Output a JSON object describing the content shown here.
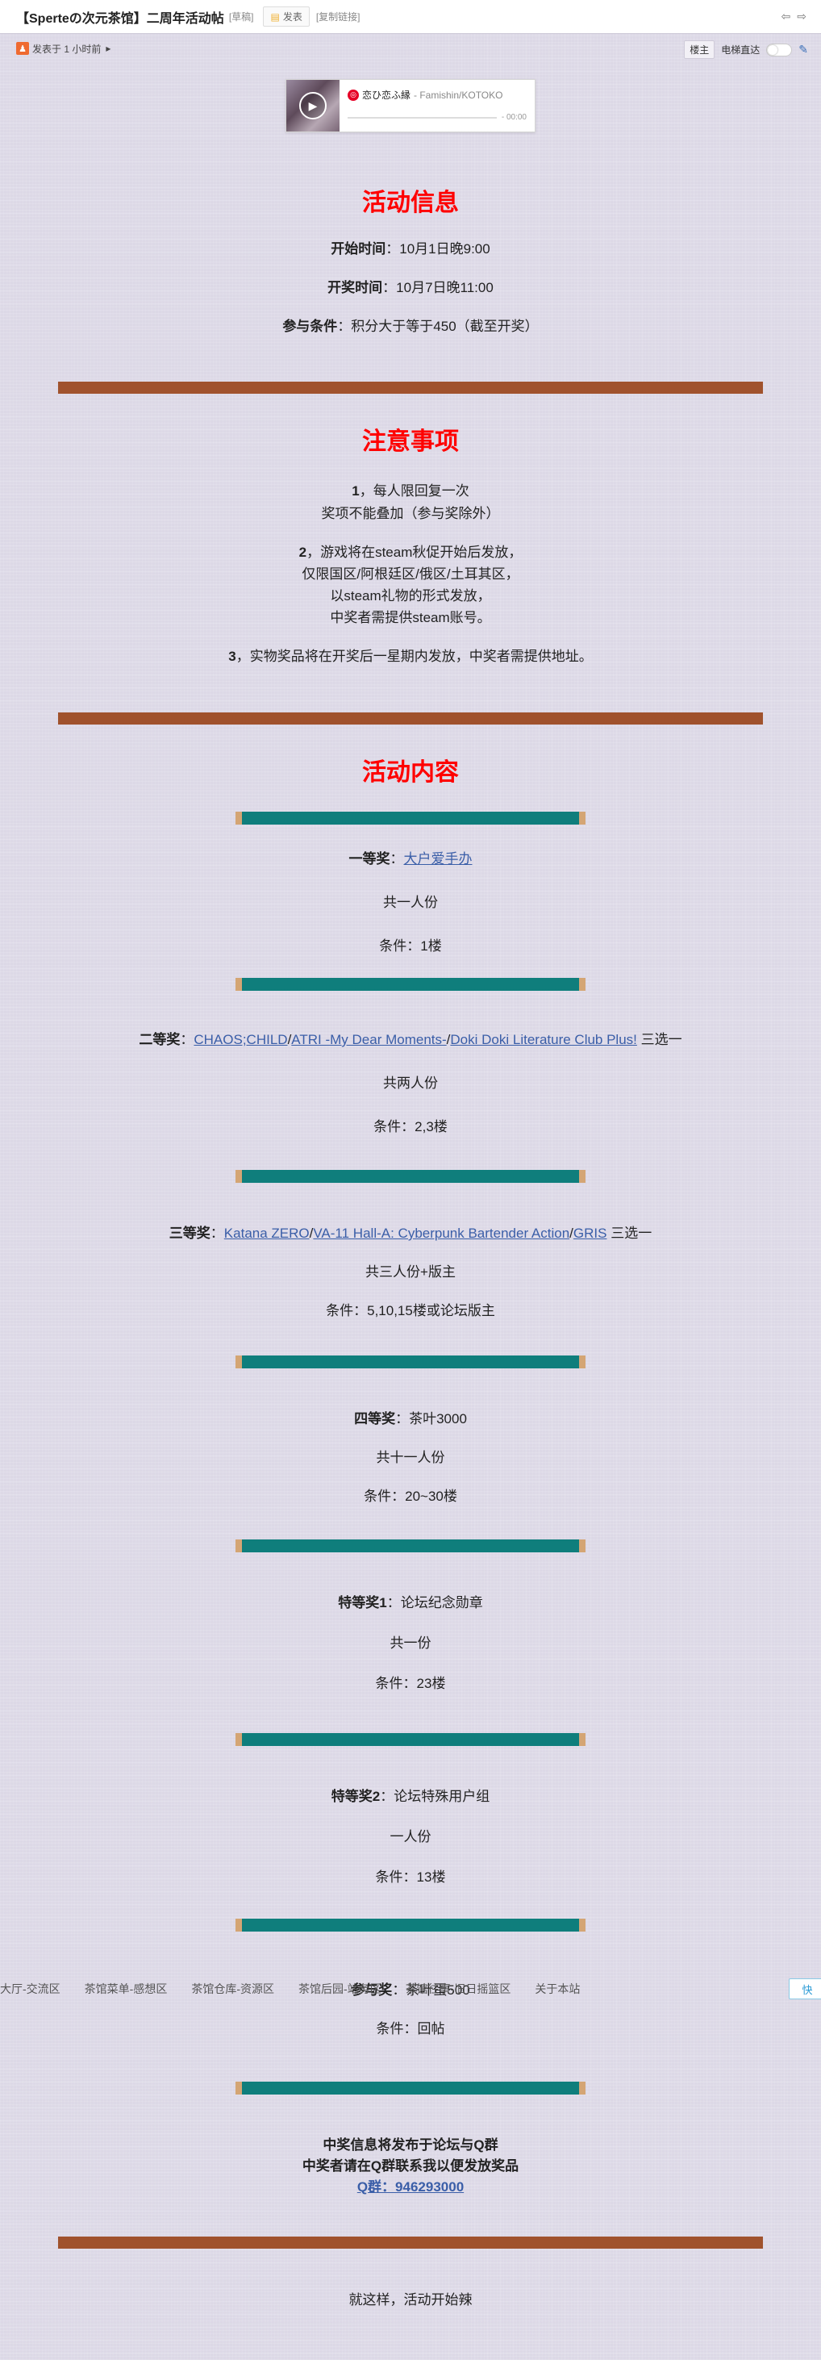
{
  "header": {
    "title": "【Sperteの次元茶馆】二周年活动帖",
    "draft_label": "[草稿]",
    "reply_label": "发表",
    "copy_label": "[复制链接]"
  },
  "subbar": {
    "author_prefix": "发表于 1 小时前",
    "owner_tag": "楼主",
    "elevator_label": "电梯直达"
  },
  "player": {
    "song": "恋ひ恋ふ縁",
    "artist": " - Famishin/KOTOKO",
    "time": "- 00:00"
  },
  "section_info": {
    "title": "活动信息",
    "start_label": "开始时间",
    "start_value": "：10月1日晚9:00",
    "draw_label": "开奖时间",
    "draw_value": "：10月7日晚11:00",
    "cond_label": "参与条件",
    "cond_value": "：积分大于等于450（截至开奖）"
  },
  "section_notes": {
    "title": "注意事项",
    "n1_num": "1",
    "n1_a": "，每人限回复一次",
    "n1_b": "奖项不能叠加（参与奖除外）",
    "n2_num": "2",
    "n2_a": "，游戏将在steam秋促开始后发放，",
    "n2_b": "仅限国区/阿根廷区/俄区/土耳其区，",
    "n2_c": "以steam礼物的形式发放，",
    "n2_d": "中奖者需提供steam账号。",
    "n3_num": "3",
    "n3_a": "，实物奖品将在开奖后一星期内发放，中奖者需提供地址。"
  },
  "section_content": {
    "title": "活动内容",
    "prizes": [
      {
        "label": "一等奖",
        "sep": "：",
        "link1": "大户爱手办",
        "count": "共一人份",
        "cond": "条件：1楼"
      },
      {
        "label": "二等奖",
        "sep": "：",
        "link1": "CHAOS;CHILD",
        "slash1": "/",
        "link2": "ATRI -My Dear Moments-",
        "slash2": "/",
        "link3": "Doki Doki Literature Club Plus!",
        "tail": " 三选一",
        "count": "共两人份",
        "cond": "条件：2,3楼"
      },
      {
        "label": "三等奖",
        "sep": "：",
        "link1": "Katana ZERO",
        "slash1": "/",
        "link2": "VA-11 Hall-A: Cyberpunk Bartender Action",
        "slash2": "/",
        "link3": "GRIS",
        "tail": " 三选一",
        "count": "共三人份+版主",
        "cond": "条件：5,10,15楼或论坛版主"
      },
      {
        "label": "四等奖",
        "sep": "：",
        "value": "茶叶3000",
        "count": "共十一人份",
        "cond": "条件：20~30楼"
      },
      {
        "label": "特等奖1",
        "sep": "：",
        "value": "论坛纪念勋章",
        "count": "共一份",
        "cond": "条件：23楼"
      },
      {
        "label": "特等奖2",
        "sep": "：",
        "value": "论坛特殊用户组",
        "count": "一人份",
        "cond": "条件：13楼"
      },
      {
        "label": "参与奖",
        "sep": "：",
        "value": "茶叶蛋500",
        "cond": "条件：回帖"
      }
    ],
    "notice_1": "中奖信息将发布于论坛与Q群",
    "notice_2": "中奖者请在Q群联系我以便发放奖品",
    "qq": "Q群：946293000",
    "closing": "就这样，活动开始辣"
  },
  "footer_nav": {
    "items": [
      "茶馆大厅-交流区",
      "茶馆菜单-感想区",
      "茶馆仓库-资源区",
      "茶馆后园-站务区",
      "茶馆往事-旧日摇篮区",
      "关于本站"
    ],
    "quick": "快"
  }
}
